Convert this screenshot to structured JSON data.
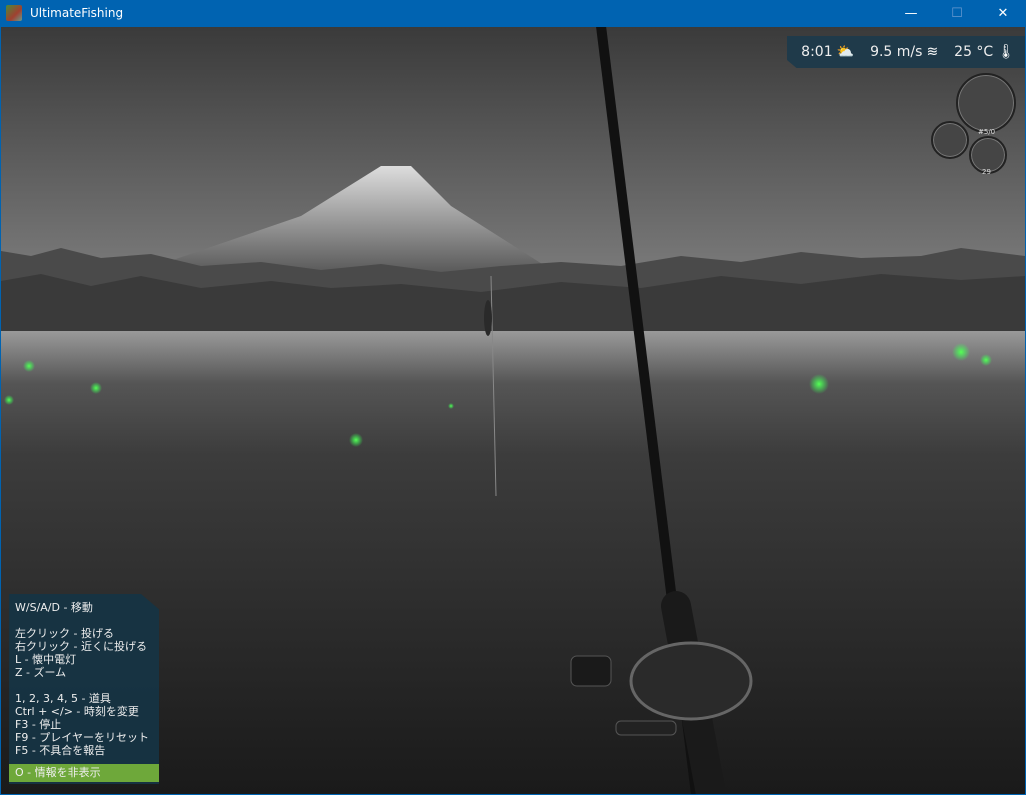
{
  "window": {
    "title": "UltimateFishing",
    "minimize": "—",
    "maximize": "☐",
    "close": "✕"
  },
  "hud": {
    "time": "8:01",
    "weather_icon": "partly-cloudy-icon",
    "wind": "9.5 m/s",
    "wind_icon": "wind-icon",
    "temperature": "25 °C",
    "temp_icon": "thermometer-icon"
  },
  "slots": [
    {
      "label": ""
    },
    {
      "label": "#5/0"
    },
    {
      "label": "29"
    }
  ],
  "help": {
    "lines": [
      "W/S/A/D - 移動",
      "",
      "左クリック - 投げる",
      "右クリック - 近くに投げる",
      "L - 懐中電灯",
      "Z - ズーム",
      "",
      "1, 2, 3, 4, 5 - 道具",
      "Ctrl + </> - 時刻を変更",
      "F3 - 停止",
      "F9 - プレイヤーをリセット",
      "F5 - 不具合を報告"
    ],
    "hide_button": "O - 情報を非表示"
  },
  "colors": {
    "titlebar": "#0063b1",
    "panel": "#163444",
    "hide_button": "#6ea83a",
    "firefly": "#3cff50"
  }
}
